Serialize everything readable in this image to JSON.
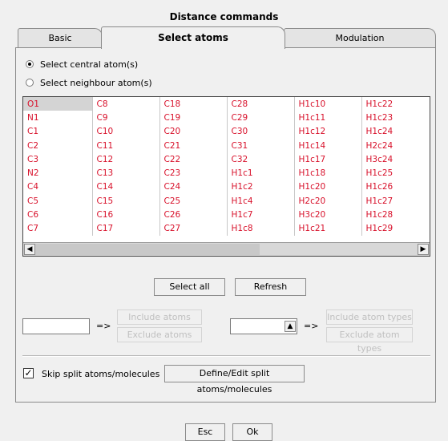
{
  "dialog": {
    "title": "Distance commands"
  },
  "tabs": [
    {
      "label": "Basic"
    },
    {
      "label": "Select atoms",
      "active": true
    },
    {
      "label": "Modulation"
    }
  ],
  "radios": [
    {
      "label": "Select central atom(s)",
      "checked": true
    },
    {
      "label": "Select neighbour atom(s)",
      "checked": false
    }
  ],
  "atom_grid": {
    "selected": "O1",
    "columns": [
      [
        "O1",
        "N1",
        "C1",
        "C2",
        "C3",
        "N2",
        "C4",
        "C5",
        "C6",
        "C7"
      ],
      [
        "C8",
        "C9",
        "C10",
        "C11",
        "C12",
        "C13",
        "C14",
        "C15",
        "C16",
        "C17"
      ],
      [
        "C18",
        "C19",
        "C20",
        "C21",
        "C22",
        "C23",
        "C24",
        "C25",
        "C26",
        "C27"
      ],
      [
        "C28",
        "C29",
        "C30",
        "C31",
        "C32",
        "H1c1",
        "H1c2",
        "H1c4",
        "H1c7",
        "H1c8"
      ],
      [
        "H1c10",
        "H1c11",
        "H1c12",
        "H1c14",
        "H1c17",
        "H1c18",
        "H1c20",
        "H2c20",
        "H3c20",
        "H1c21"
      ],
      [
        "H1c22",
        "H1c23",
        "H1c24",
        "H2c24",
        "H3c24",
        "H1c25",
        "H1c26",
        "H1c27",
        "H1c28",
        "H1c29"
      ]
    ]
  },
  "buttons": {
    "select_all": "Select all",
    "refresh": "Refresh",
    "include_atoms": "Include atoms",
    "exclude_atoms": "Exclude atoms",
    "include_atom_types": "Include atom types",
    "exclude_atom_types": "Exclude atom types",
    "define_split": "Define/Edit split atoms/molecules",
    "esc": "Esc",
    "ok": "Ok"
  },
  "arrow_label": "=>",
  "skip_split": {
    "label": "Skip split atoms/molecules",
    "checked": true
  },
  "fields": {
    "atom_input": "",
    "atom_type_combo": ""
  },
  "icons": {
    "scroll_left": "triangle-left",
    "scroll_right": "triangle-right",
    "combo": "triangle-up"
  }
}
